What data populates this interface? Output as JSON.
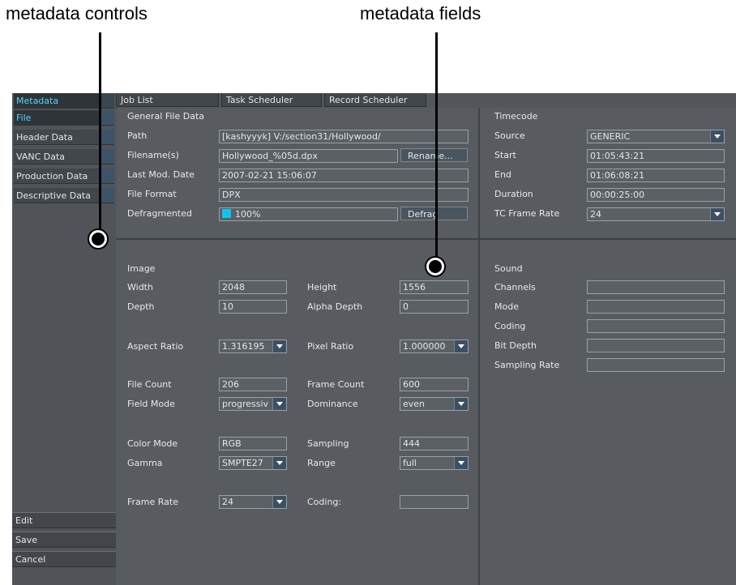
{
  "callouts": {
    "controls": "metadata controls",
    "fields": "metadata fields"
  },
  "colors": {
    "accent": "#4fd6ff",
    "progress": "#11c4ee"
  },
  "sidebar": {
    "header": "Metadata",
    "items": [
      {
        "label": "File",
        "active": true
      },
      {
        "label": "Header Data"
      },
      {
        "label": "VANC Data"
      },
      {
        "label": "Production Data"
      },
      {
        "label": "Descriptive Data"
      }
    ],
    "actions": [
      "Edit",
      "Save",
      "Cancel"
    ]
  },
  "tabs": [
    "Job List",
    "Task Scheduler",
    "Record Scheduler"
  ],
  "general": {
    "title": "General File Data",
    "path_label": "Path",
    "path_value": "[kashyyyk] V:/section31/Hollywood/",
    "filename_label": "Filename(s)",
    "filename_value": "Hollywood_%05d.dpx",
    "rename_button": "Rename...",
    "lastmod_label": "Last Mod. Date",
    "lastmod_value": "2007-02-21 15:06:07",
    "format_label": "File Format",
    "format_value": "DPX",
    "defrag_label": "Defragmented",
    "defrag_value": "100%",
    "defrag_fraction": 1.0,
    "defrag_button": "Defrag"
  },
  "timecode": {
    "title": "Timecode",
    "source_label": "Source",
    "source_value": "GENERIC",
    "start_label": "Start",
    "start_value": "01:05:43:21",
    "end_label": "End",
    "end_value": "01:06:08:21",
    "duration_label": "Duration",
    "duration_value": "00:00:25:00",
    "rate_label": "TC Frame Rate",
    "rate_value": "24"
  },
  "image": {
    "title": "Image",
    "width_label": "Width",
    "width_value": "2048",
    "height_label": "Height",
    "height_value": "1556",
    "depth_label": "Depth",
    "depth_value": "10",
    "alpha_label": "Alpha Depth",
    "alpha_value": "0",
    "aspect_label": "Aspect Ratio",
    "aspect_value": "1.316195",
    "pixel_label": "Pixel Ratio",
    "pixel_value": "1.000000",
    "filecount_label": "File Count",
    "filecount_value": "206",
    "framecount_label": "Frame Count",
    "framecount_value": "600",
    "fieldmode_label": "Field Mode",
    "fieldmode_value": "progressiv",
    "dominance_label": "Dominance",
    "dominance_value": "even",
    "colormode_label": "Color Mode",
    "colormode_value": "RGB",
    "sampling_label": "Sampling",
    "sampling_value": "444",
    "gamma_label": "Gamma",
    "gamma_value": "SMPTE27",
    "range_label": "Range",
    "range_value": "full",
    "framerate_label": "Frame Rate",
    "framerate_value": "24",
    "coding_label": "Coding:",
    "coding_value": ""
  },
  "sound": {
    "title": "Sound",
    "channels_label": "Channels",
    "mode_label": "Mode",
    "coding_label": "Coding",
    "bitdepth_label": "Bit Depth",
    "samplingrate_label": "Sampling Rate"
  }
}
